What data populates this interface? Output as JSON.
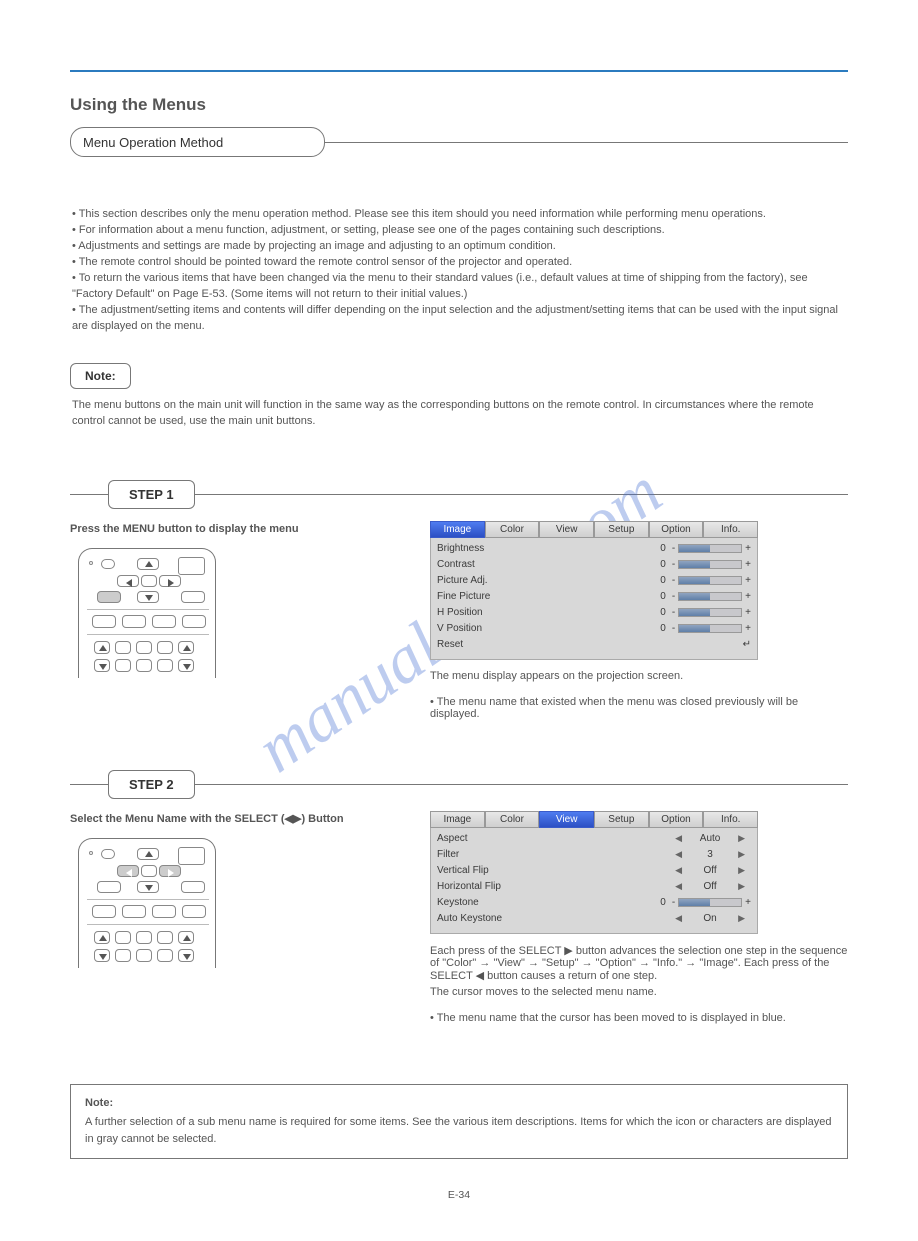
{
  "page": {
    "headerTitle": "Using the Menus",
    "introCapsule": "Menu Operation Method",
    "introParas": [
      "• This section describes only the menu operation method. Please see this item should you need information while performing menu operations.",
      "• For information about a menu function, adjustment, or setting, please see one of the pages containing such descriptions.",
      "• Adjustments and settings are made by projecting an image and adjusting to an optimum condition.",
      "• The remote control should be pointed toward the remote control sensor of the projector and operated.",
      "• To return the various items that have been changed via the menu to their standard values (i.e., default values at time of shipping from the factory), see \"Factory Default\" on Page E-53. (Some items will not return to their initial values.)",
      "• The adjustment/setting items and contents will differ depending on the input selection and the adjustment/setting items that can be used with the input signal are displayed on the menu."
    ],
    "noteLabel": "Note:",
    "noteText": "The menu buttons on the main unit will function in the same way as the corresponding buttons on the remote control. In circumstances where the remote control cannot be used, use the main unit buttons.",
    "pageNumber": "E-34",
    "watermark": "manualshive.com"
  },
  "step1": {
    "label": "STEP 1",
    "heading": "Press the MENU button to display the menu",
    "pressLabel": "Press",
    "buttonName": "MENU"
  },
  "osd1": {
    "tabs": [
      "Image",
      "Color",
      "View",
      "Setup",
      "Option",
      "Info."
    ],
    "active": "Image",
    "rows": [
      {
        "label": "Brightness",
        "value": "0"
      },
      {
        "label": "Contrast",
        "value": "0"
      },
      {
        "label": "Picture Adj.",
        "value": "0"
      },
      {
        "label": "Fine Picture",
        "value": "0"
      },
      {
        "label": "H Position",
        "value": "0"
      },
      {
        "label": "V Position",
        "value": "0"
      }
    ],
    "reset": "Reset",
    "caption": "The menu display appears on the projection screen.",
    "bullet": "• The menu name that existed when the menu was closed previously will be displayed."
  },
  "step2": {
    "label": "STEP 2",
    "heading": "Select the Menu Name with the SELECT (◀▶) Button",
    "pressLabel": "Press",
    "buttonLeft": "left",
    "buttonRight": "right",
    "caption": "Each press of the SELECT ▶ button advances the selection one step in the sequence of \"Color\" → \"View\" → \"Setup\" → \"Option\" → \"Info.\" → \"Image\". Each press of the SELECT ◀ button causes a return of one step.",
    "sub": "The cursor moves to the selected menu name."
  },
  "osd2": {
    "tabs": [
      "Image",
      "Color",
      "View",
      "Setup",
      "Option",
      "Info."
    ],
    "active": "View",
    "rows": [
      {
        "label": "Aspect",
        "value": "Auto"
      },
      {
        "label": "Filter",
        "value": "3"
      },
      {
        "label": "Vertical Flip",
        "value": "Off"
      },
      {
        "label": "Horizontal Flip",
        "value": "Off"
      }
    ],
    "keystone": {
      "label": "Keystone",
      "value": "0"
    },
    "autoKeystone": {
      "label": "Auto Keystone",
      "value": "On"
    },
    "bullet": "• The menu name that the cursor has been moved to is displayed in blue."
  },
  "bigNote": {
    "header": "Note:",
    "body": "A further selection of a sub menu name is required for some items. See the various item descriptions. Items for which the icon or characters are displayed in gray cannot be selected."
  }
}
